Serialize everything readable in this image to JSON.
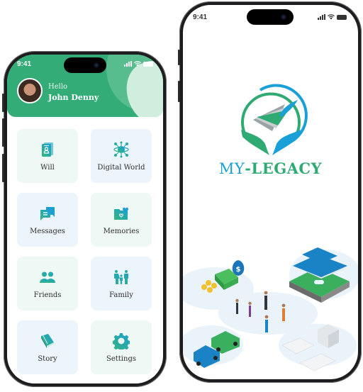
{
  "left_phone": {
    "status": {
      "time": "9:41"
    },
    "header": {
      "greeting": "Hello",
      "user_name": "John Denny",
      "background_color": "#33ac78"
    },
    "menu": [
      {
        "label": "Will",
        "icon": "will-document-icon"
      },
      {
        "label": "Digital World",
        "icon": "digital-world-icon"
      },
      {
        "label": "Messages",
        "icon": "messages-icon"
      },
      {
        "label": "Memories",
        "icon": "memories-folder-icon"
      },
      {
        "label": "Friends",
        "icon": "friends-icon"
      },
      {
        "label": "Family",
        "icon": "family-icon"
      },
      {
        "label": "Story",
        "icon": "story-book-icon"
      },
      {
        "label": "Settings",
        "icon": "settings-gear-icon"
      }
    ]
  },
  "right_phone": {
    "status": {
      "time": "9:41"
    },
    "brand": {
      "prefix": "MY",
      "suffix": "-LEGACY",
      "prefix_color": "#1aa0d8",
      "suffix_color": "#2eaa72"
    },
    "illustration": "legacy-assets-illustration"
  },
  "colors": {
    "accent_green": "#2eaa72",
    "accent_blue": "#1aa0d8",
    "tile_green": "#eef8f4",
    "tile_blue": "#ecf5fb"
  }
}
